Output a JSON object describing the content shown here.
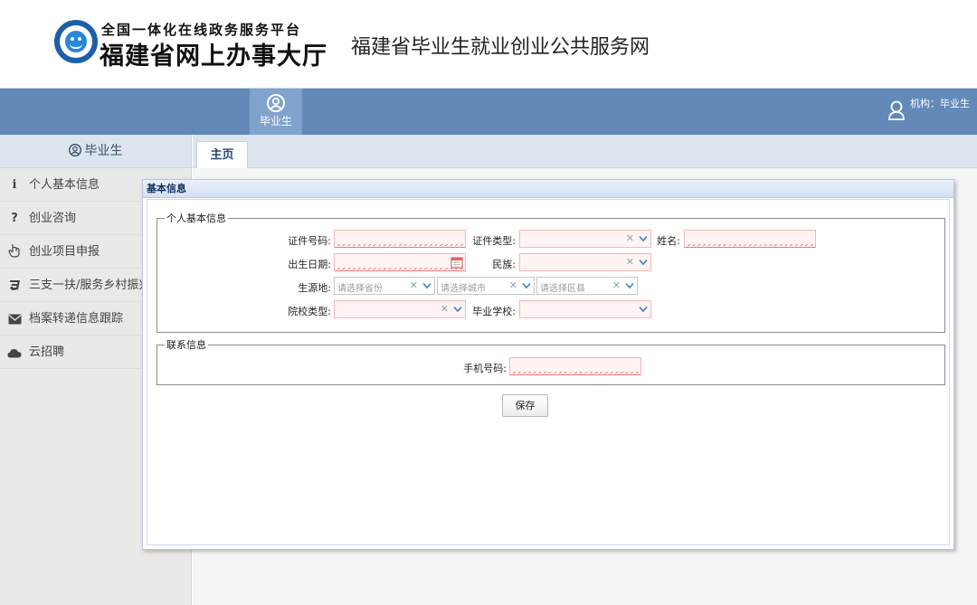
{
  "header": {
    "logo_top": "全国一体化在线政务服务平台",
    "logo_main": "福建省网上办事大厅",
    "site_title": "福建省毕业生就业创业公共服务网"
  },
  "navbar": {
    "item_label": "毕业生",
    "org_text": "机构：毕业生"
  },
  "sidebar": {
    "title": "毕业生",
    "items": [
      {
        "label": "个人基本信息",
        "icon": "info-icon"
      },
      {
        "label": "创业咨询",
        "icon": "question-icon"
      },
      {
        "label": "创业项目申报",
        "icon": "hand-pointer-icon"
      },
      {
        "label": "三支一扶/服务乡村振兴",
        "icon": "css3-icon"
      },
      {
        "label": "档案转递信息跟踪",
        "icon": "envelope-icon"
      },
      {
        "label": "云招聘",
        "icon": "cloud-icon"
      }
    ]
  },
  "tabs": [
    {
      "label": "主页"
    }
  ],
  "panel": {
    "title": "基本信息",
    "personal": {
      "legend": "个人基本信息",
      "id_number_label": "证件号码:",
      "id_type_label": "证件类型:",
      "name_label": "姓名:",
      "birth_label": "出生日期:",
      "ethnicity_label": "民族:",
      "origin_label": "生源地:",
      "province_placeholder": "请选择省份",
      "city_placeholder": "请选择城市",
      "district_placeholder": "请选择区县",
      "school_type_label": "院校类型:",
      "school_label": "毕业学校:"
    },
    "contact": {
      "legend": "联系信息",
      "phone_label": "手机号码:"
    },
    "save_label": "保存"
  },
  "colors": {
    "navbar": "#6289b8",
    "required_field": "#fff3f3",
    "panel_title": "#0e2d5f"
  }
}
